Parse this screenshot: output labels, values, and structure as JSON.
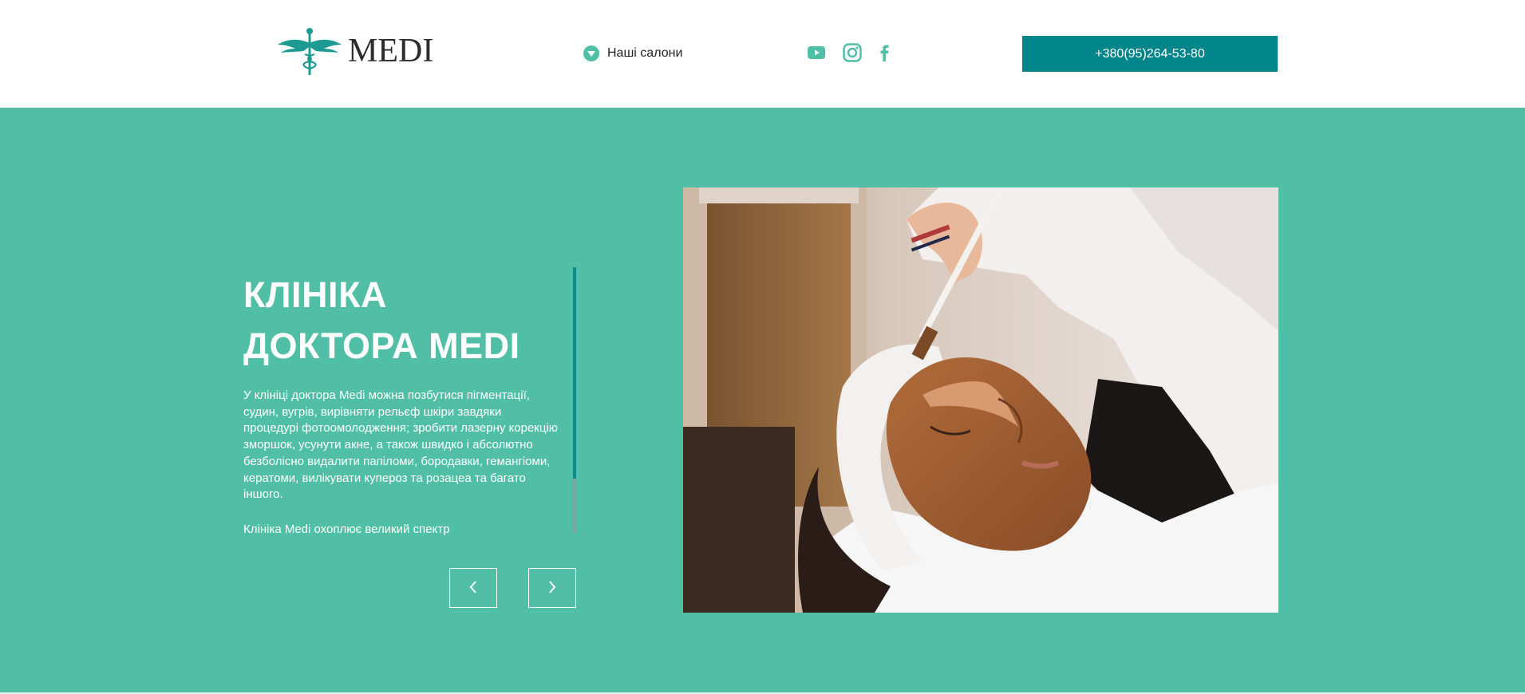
{
  "header": {
    "logo_text": "MEDI",
    "logo_icon": "caduceus-icon",
    "salons_label": "Наші салони",
    "salons_icon": "chevron-down-circle-icon",
    "socials": [
      {
        "name": "youtube-icon"
      },
      {
        "name": "instagram-icon"
      },
      {
        "name": "facebook-icon"
      }
    ],
    "phone": "+380(95)264-53-80"
  },
  "hero": {
    "title_line1": "КЛІНІКА",
    "title_line2": "ДОКТОРА MEDI",
    "description": "У клініці доктора Medi можна позбутися пігментації, судин, вугрів, вирівняти рельєф шкіри завдяки процедурі фотоомолодження; зробити лазерну корекцію зморшок, усунути акне, а також швидко і абсолютно безболісно видалити папіломи, бородавки, гемангіоми, кератоми, вилікувати купероз та розацеа та багато іншого.",
    "more_text": "Клініка Medi охоплює великий спектр",
    "prev_icon": "chevron-left-icon",
    "next_icon": "chevron-right-icon"
  },
  "colors": {
    "hero_bg": "#50bfa5",
    "accent": "#00858a",
    "icon_teal": "#4fbfa5",
    "text_dark": "#222222",
    "white": "#ffffff"
  }
}
